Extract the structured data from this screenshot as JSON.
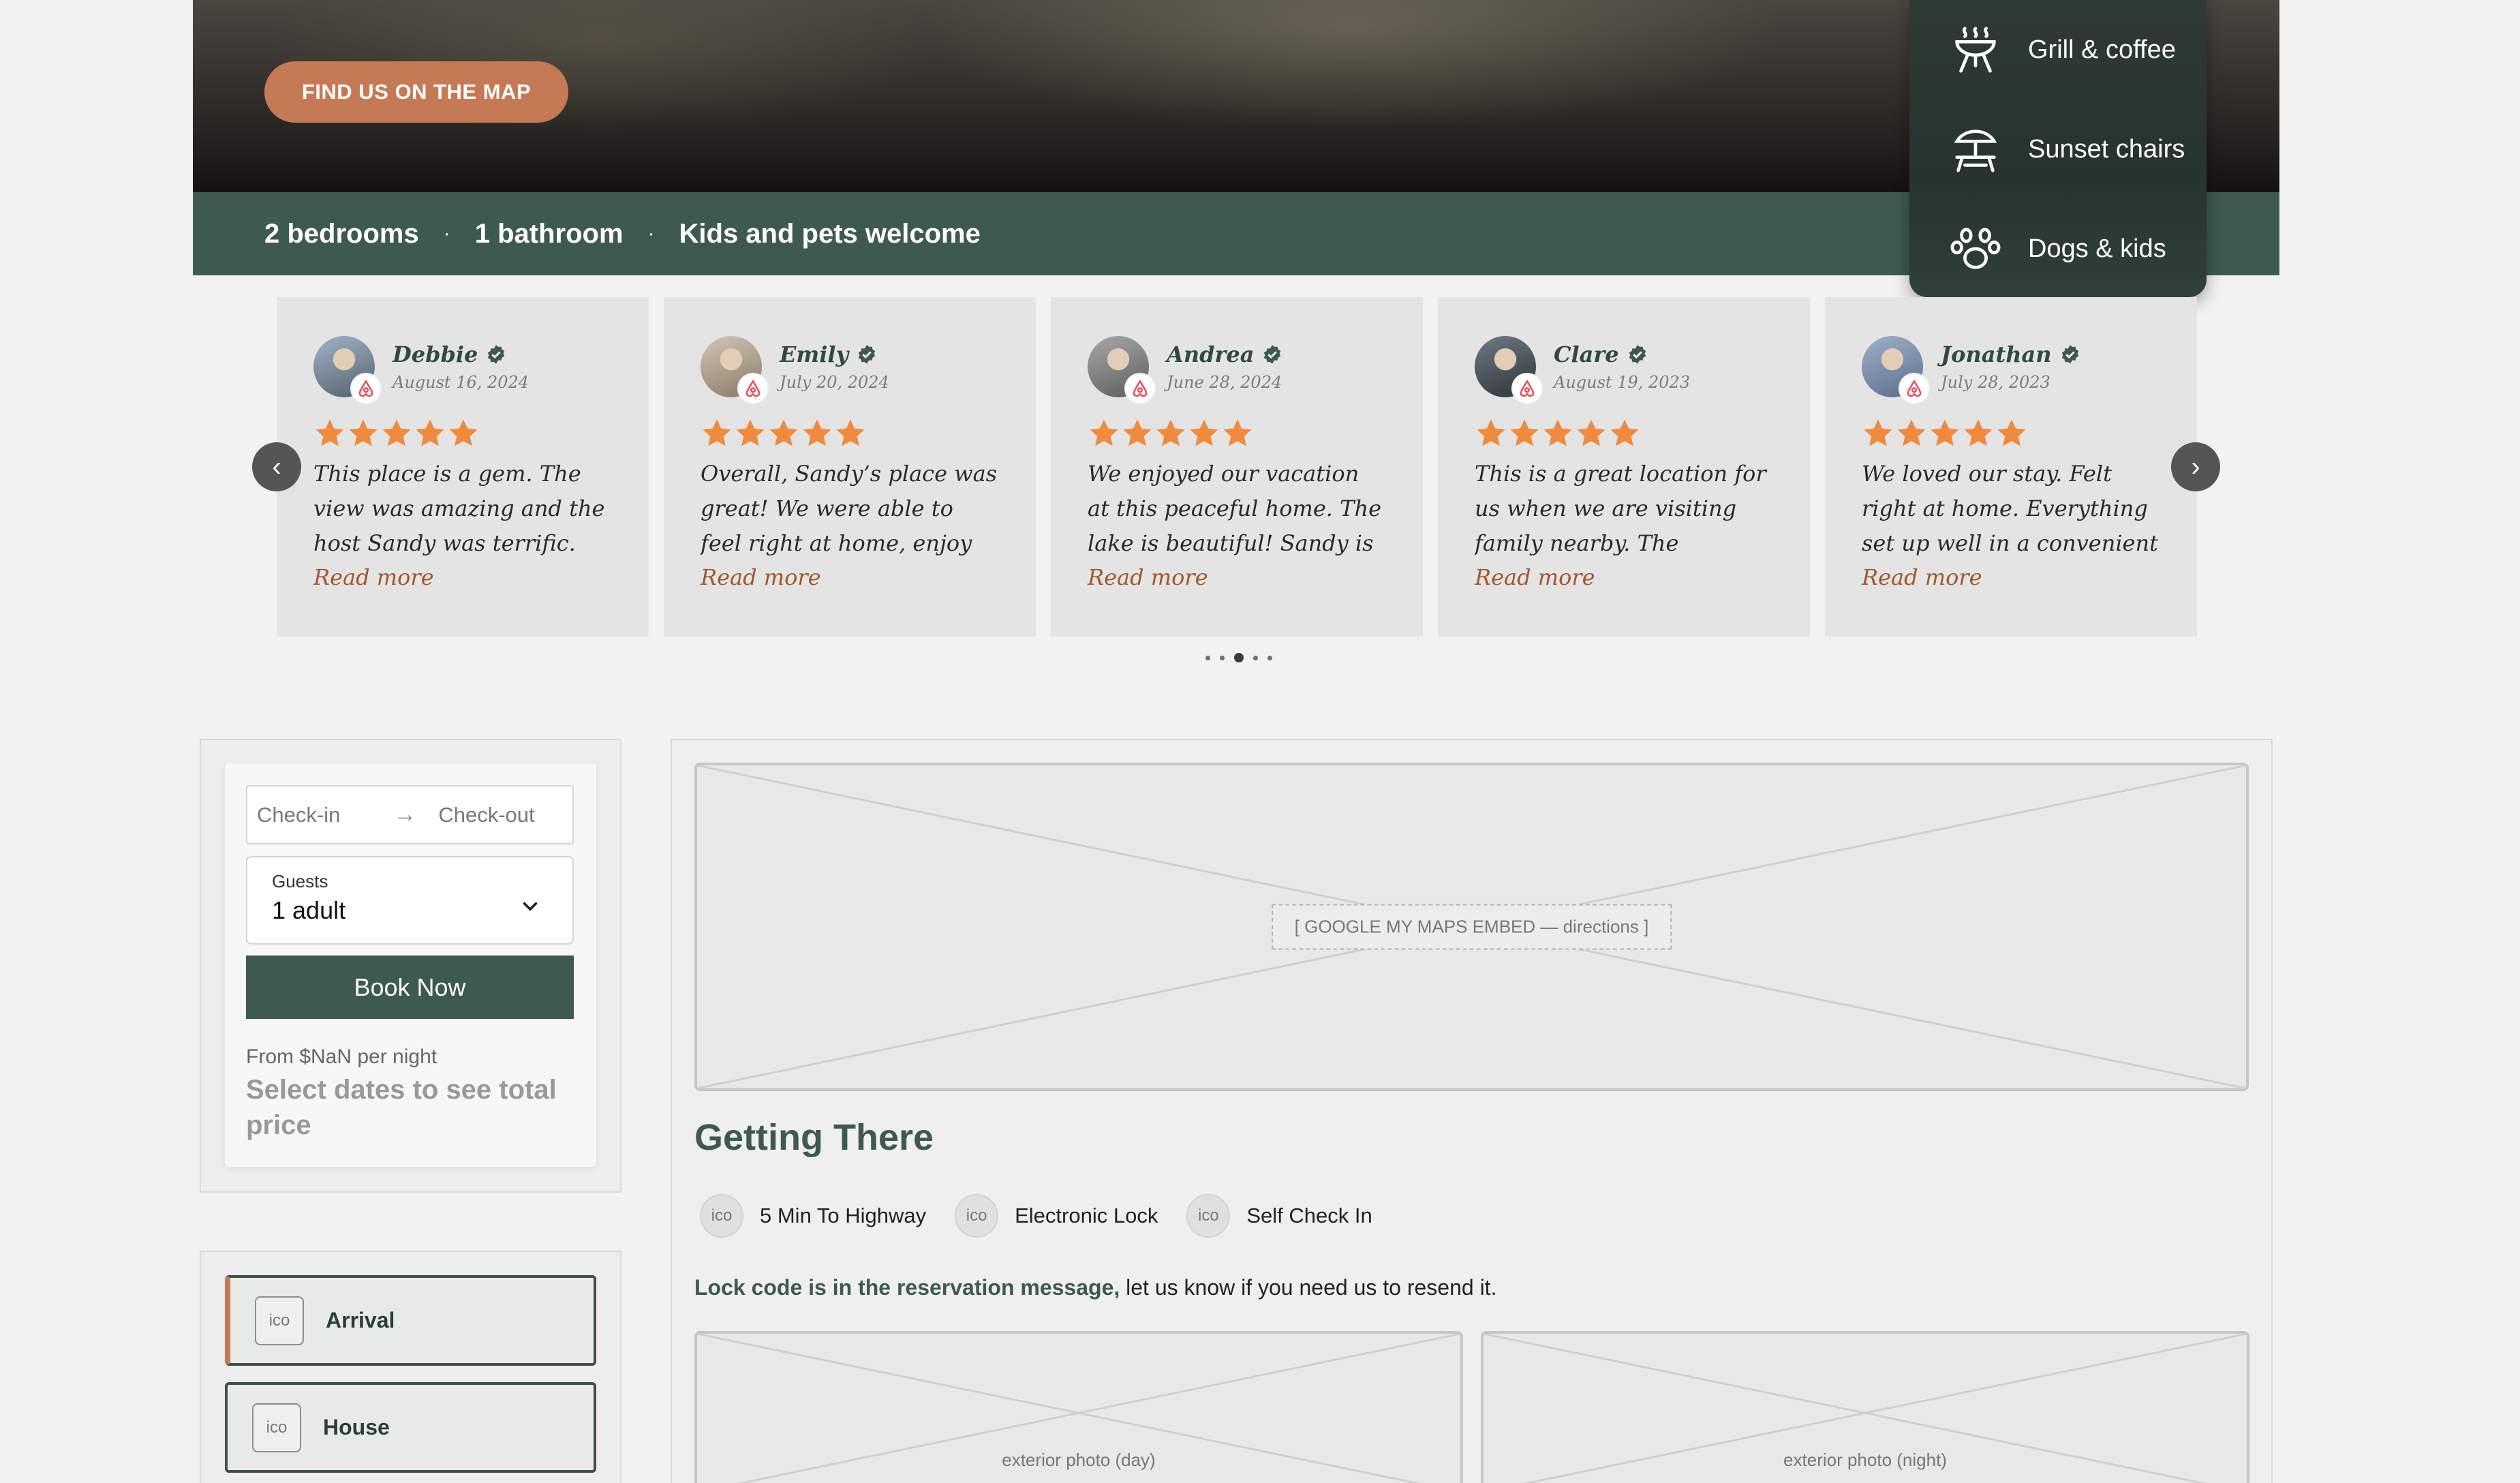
{
  "hero": {
    "map_button": "FIND US ON THE MAP"
  },
  "stats": {
    "bedrooms": "2 bedrooms",
    "bathrooms": "1 bathroom",
    "welcome": "Kids and pets welcome",
    "separator": "·"
  },
  "amenities": [
    {
      "icon": "grill-icon",
      "label": "Grill & coffee"
    },
    {
      "icon": "beach-chair-icon",
      "label": "Sunset chairs"
    },
    {
      "icon": "paw-icon",
      "label": "Dogs & kids"
    }
  ],
  "reviews": {
    "items": [
      {
        "name": "Debbie",
        "date": "August 16, 2024",
        "rating": 5,
        "text": "This place is a gem. The view was amazing and the host Sandy was terrific. sh...",
        "more": "Read more"
      },
      {
        "name": "Emily",
        "date": "July 20, 2024",
        "rating": 5,
        "text": "Overall, Sandy’s place was great! We were able to feel right at home, enjoy the...",
        "more": "Read more"
      },
      {
        "name": "Andrea",
        "date": "June 28, 2024",
        "rating": 5,
        "text": "We enjoyed our vacation at this peaceful home. The lake is beautiful! Sandy is a...",
        "more": "Read more"
      },
      {
        "name": "Clare",
        "date": "August 19, 2023",
        "rating": 5,
        "text": "This is a great location for us when we are visiting family nearby. The upgrade...",
        "more": "Read more"
      },
      {
        "name": "Jonathan",
        "date": "July 28, 2023",
        "rating": 5,
        "text": "We loved our stay. Felt right at home. Everything set up well in a convenient locatio...",
        "more": "Read more"
      }
    ],
    "prev_icon": "‹",
    "next_icon": "›",
    "dots_count": 5,
    "active_dot": 2
  },
  "booking": {
    "checkin_placeholder": "Check-in",
    "checkout_placeholder": "Check-out",
    "guests_label": "Guests",
    "guests_value": "1 adult",
    "book_button": "Book Now",
    "price_from": "From $NaN per night",
    "price_note": "Select dates to see total price"
  },
  "sidenav": {
    "items": [
      {
        "icon": "ico",
        "label": "Arrival"
      },
      {
        "icon": "ico",
        "label": "House"
      }
    ]
  },
  "main": {
    "map_placeholder": "[ GOOGLE MY MAPS EMBED — directions ]",
    "title": "Getting There",
    "chips": [
      {
        "icon": "ico",
        "label": "5 Min To Highway"
      },
      {
        "icon": "ico",
        "label": "Electronic Lock"
      },
      {
        "icon": "ico",
        "label": "Self Check In"
      }
    ],
    "lock_bold": "Lock code is in the reservation message,",
    "lock_rest": " let us know if you need us to resend it.",
    "photos": [
      "exterior photo (day)",
      "exterior photo (night)"
    ]
  },
  "colors": {
    "brand_green": "#3e5a50",
    "accent_copper": "#c57a55",
    "star_orange": "#f08a3c",
    "read_more": "#a0582c"
  }
}
